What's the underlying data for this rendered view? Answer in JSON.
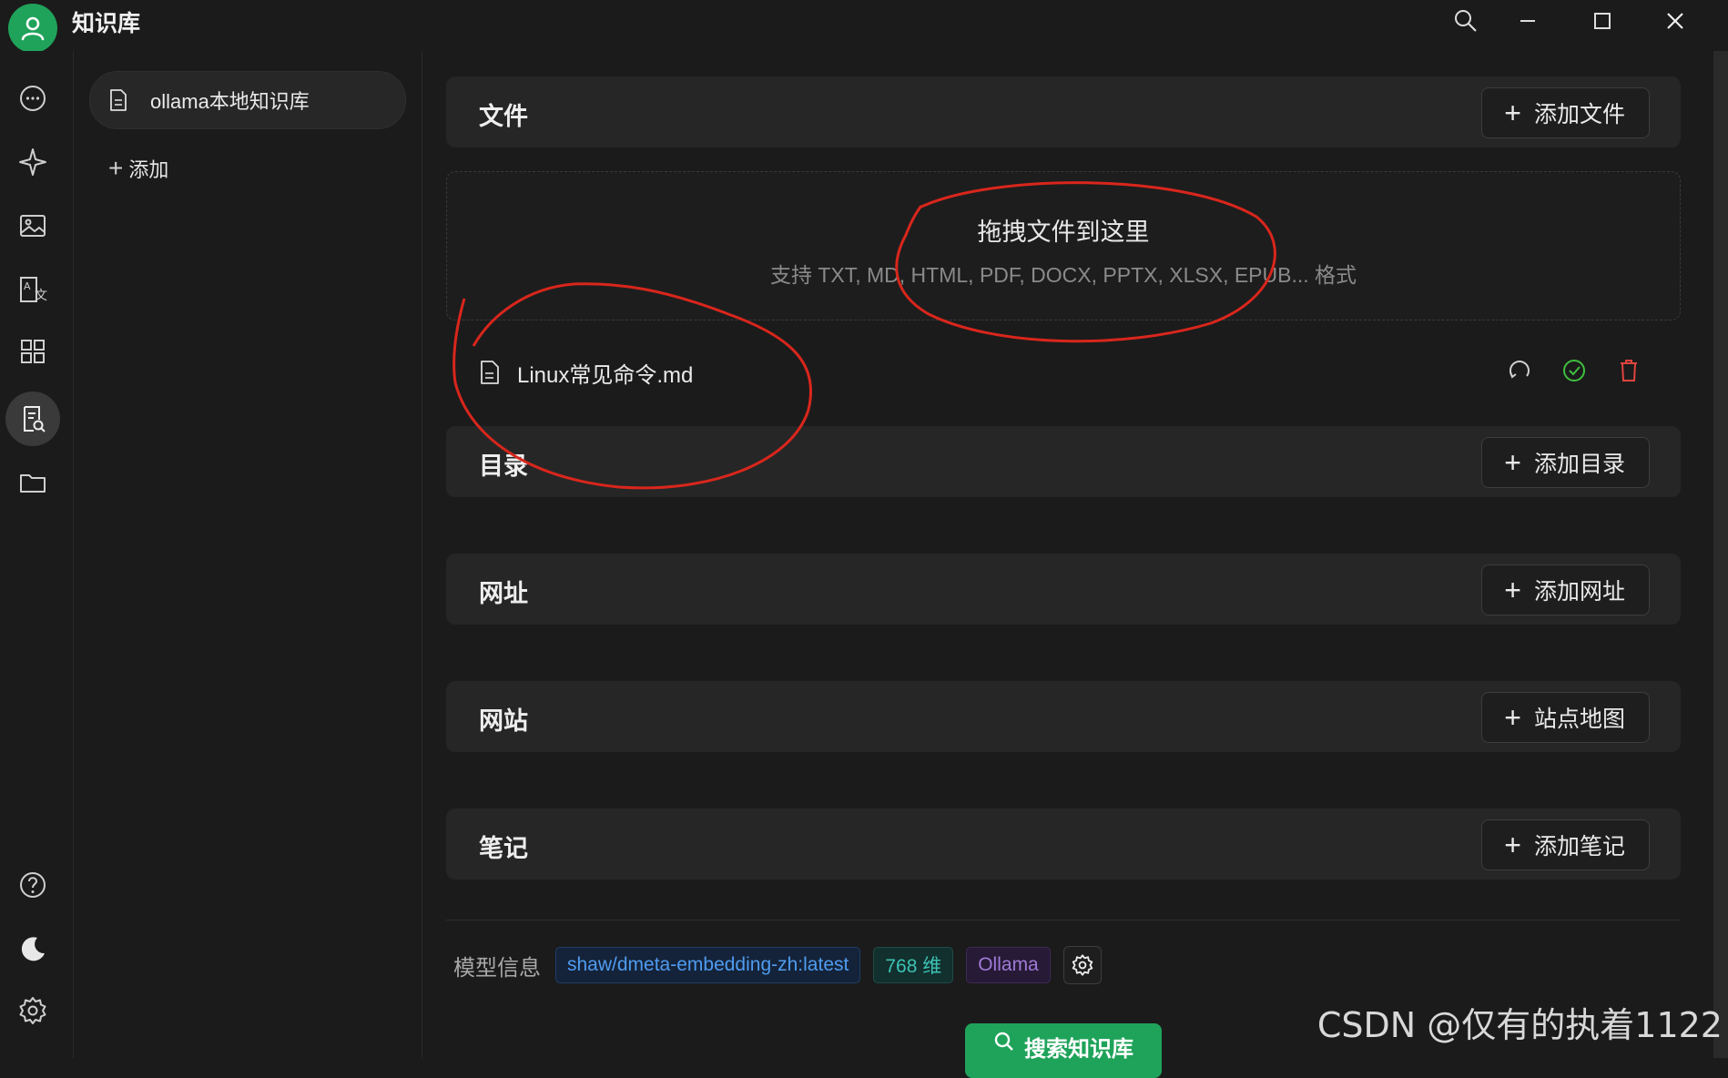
{
  "app": {
    "title": "知识库"
  },
  "knowledge_bases": {
    "items": [
      {
        "label": "ollama本地知识库"
      }
    ],
    "add_label": "添加"
  },
  "sections": {
    "files": {
      "title": "文件",
      "add_label": "添加文件"
    },
    "dropzone": {
      "title": "拖拽文件到这里",
      "subtitle": "支持 TXT, MD, HTML, PDF, DOCX, PPTX, XLSX, EPUB... 格式"
    },
    "file_list": [
      {
        "name": "Linux常见命令.md"
      }
    ],
    "directories": {
      "title": "目录",
      "add_label": "添加目录"
    },
    "urls": {
      "title": "网址",
      "add_label": "添加网址"
    },
    "websites": {
      "title": "网站",
      "add_label": "站点地图"
    },
    "notes": {
      "title": "笔记",
      "add_label": "添加笔记"
    }
  },
  "model_info": {
    "label": "模型信息",
    "model": "shaw/dmeta-embedding-zh:latest",
    "dimensions": "768 维",
    "provider": "Ollama"
  },
  "search_button": {
    "label": "搜索知识库"
  },
  "watermark": "CSDN @仅有的执着1122",
  "colors": {
    "accent": "#1fa35a",
    "success": "#3fbf3f",
    "danger": "#e0443e"
  },
  "icons": {
    "rail": [
      "chat-icon",
      "sparkle-icon",
      "image-icon",
      "translate-icon",
      "apps-icon",
      "knowledge-icon",
      "folder-icon"
    ],
    "rail_bottom": [
      "help-icon",
      "moon-icon",
      "settings-icon"
    ]
  }
}
